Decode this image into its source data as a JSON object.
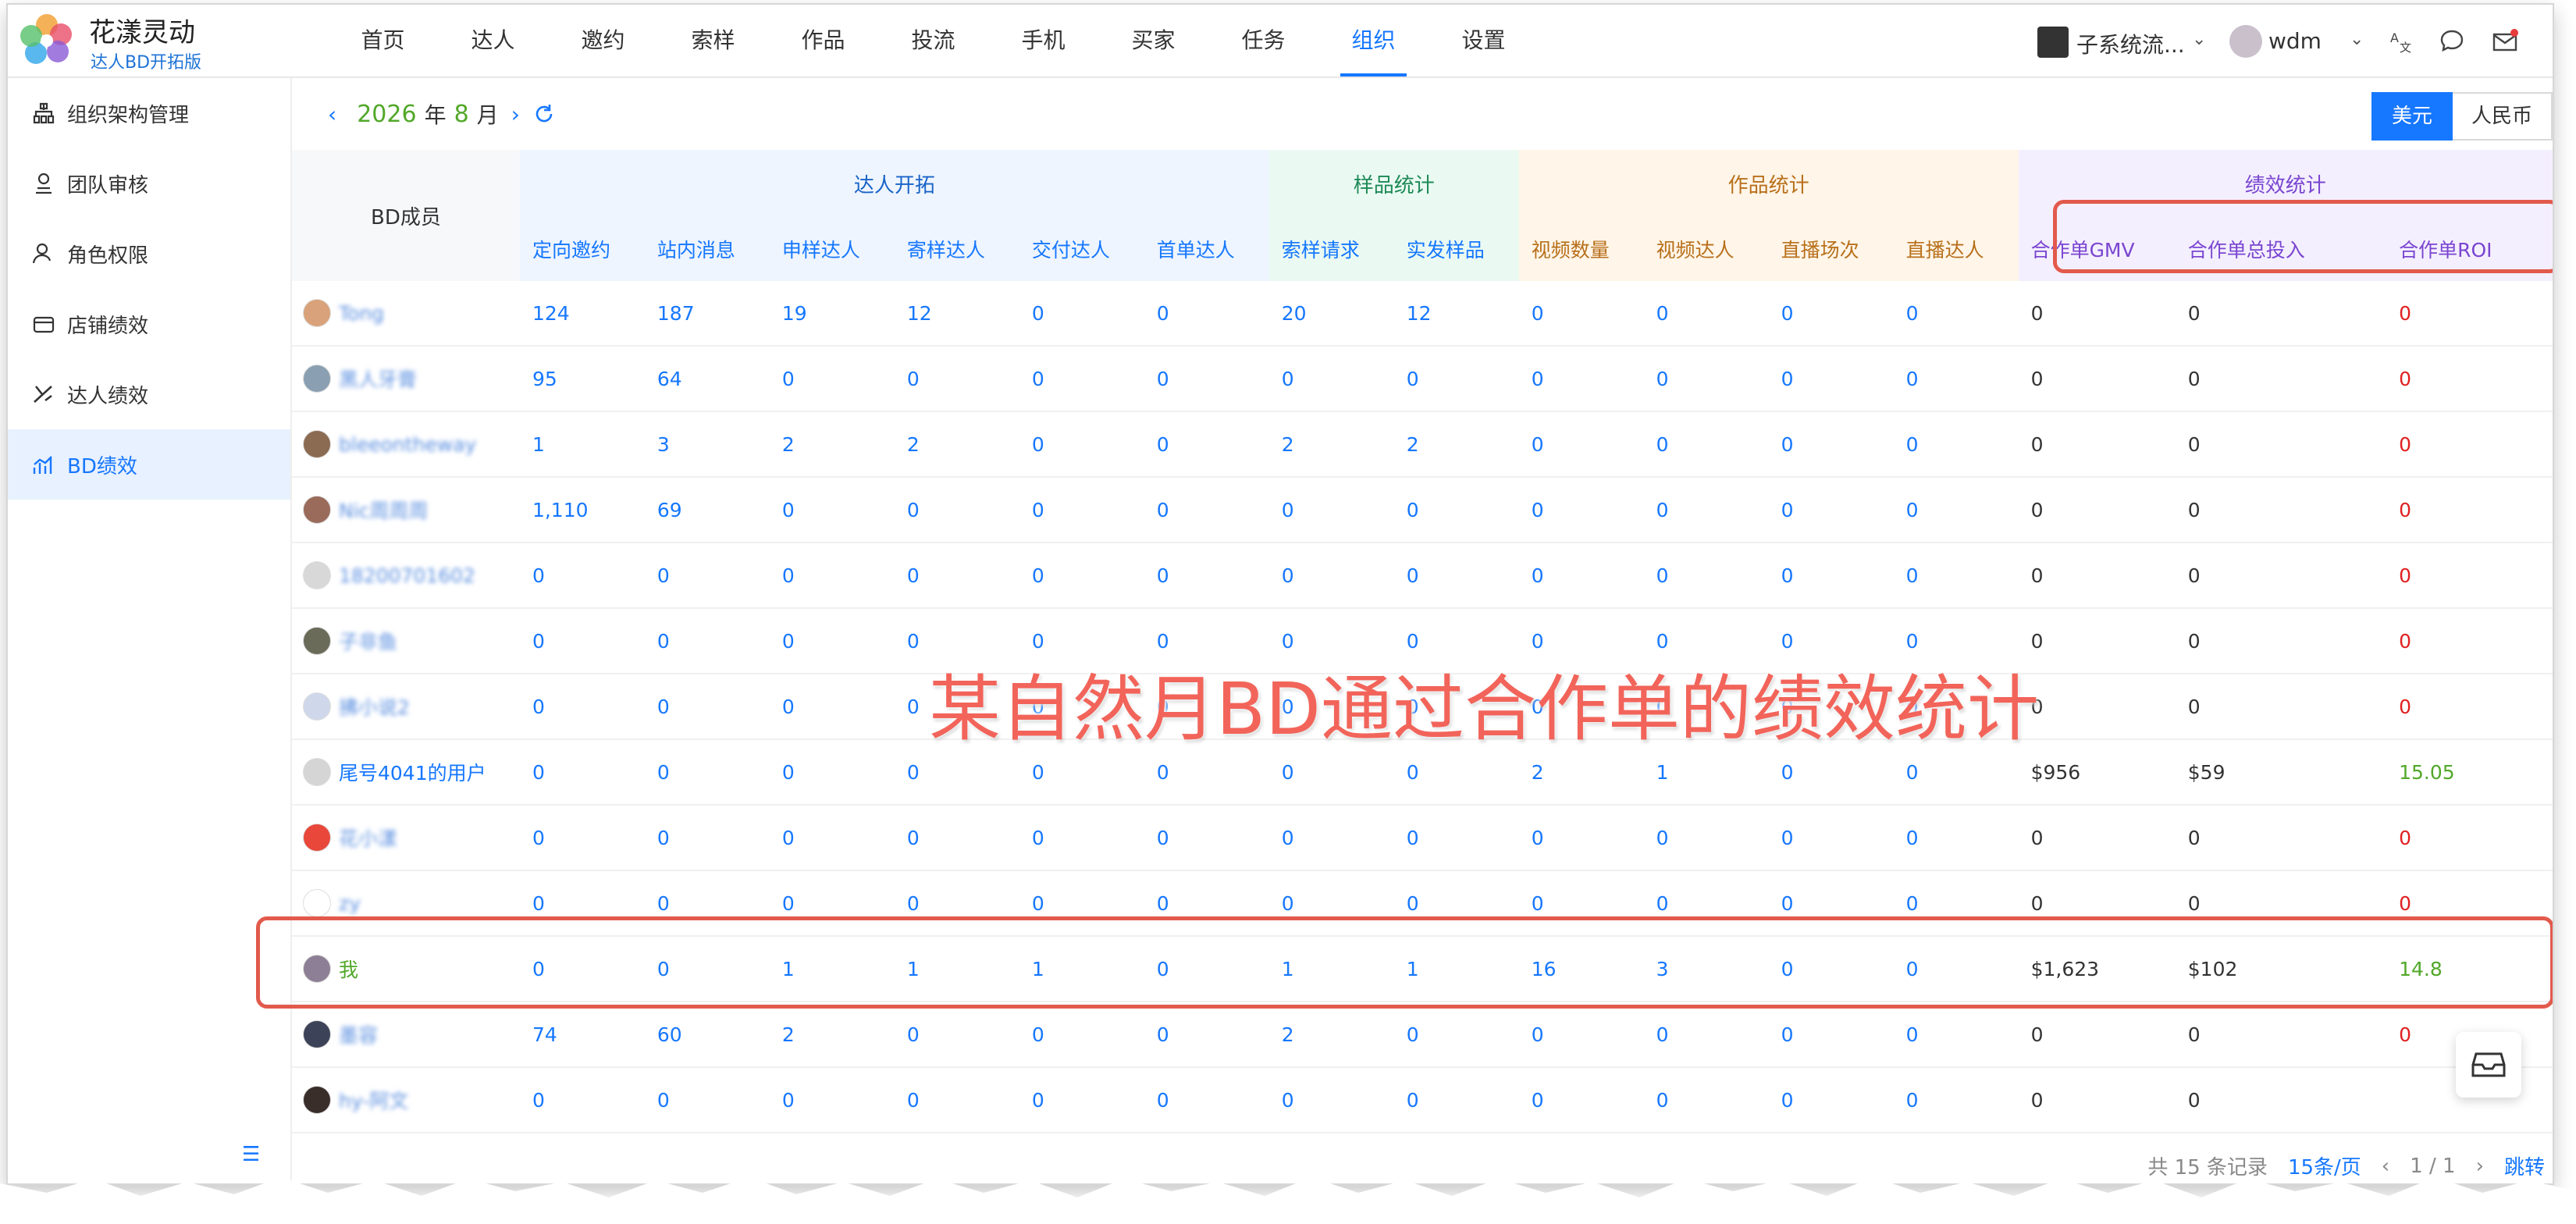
{
  "app": {
    "title": "花漾灵动",
    "subtitle": "达人BD开拓版"
  },
  "nav": [
    "首页",
    "达人",
    "邀约",
    "索样",
    "作品",
    "投流",
    "手机",
    "买家",
    "任务",
    "组织",
    "设置"
  ],
  "nav_active_index": 9,
  "topbar": {
    "subsystem": "子系统流...",
    "user": "wdm"
  },
  "sidebar": [
    "组织架构管理",
    "团队审核",
    "角色权限",
    "店铺绩效",
    "达人绩效",
    "BD绩效"
  ],
  "sidebar_active_index": 5,
  "datebar": {
    "year": "2026",
    "year_unit": "年",
    "month": "8",
    "month_unit": "月"
  },
  "currency": {
    "usd": "美元",
    "cny": "人民币"
  },
  "table": {
    "bd_header": "BD成员",
    "groups": [
      "达人开拓",
      "样品统计",
      "作品统计",
      "绩效统计"
    ],
    "columns": [
      "定向邀约",
      "站内消息",
      "申样达人",
      "寄样达人",
      "交付达人",
      "首单达人",
      "索样请求",
      "实发样品",
      "视频数量",
      "视频达人",
      "直播场次",
      "直播达人",
      "合作单GMV",
      "合作单总投入",
      "合作单ROI"
    ],
    "rows": [
      {
        "name": "Tong",
        "avatar": "#d9a27a",
        "blurred": true,
        "v": [
          "124",
          "187",
          "19",
          "12",
          "0",
          "0",
          "20",
          "12",
          "0",
          "0",
          "0",
          "0",
          "0",
          "0",
          "0"
        ]
      },
      {
        "name": "黑人牙膏",
        "avatar": "#8aa0b2",
        "blurred": true,
        "v": [
          "95",
          "64",
          "0",
          "0",
          "0",
          "0",
          "0",
          "0",
          "0",
          "0",
          "0",
          "0",
          "0",
          "0",
          "0"
        ]
      },
      {
        "name": "bleeontheway",
        "avatar": "#8b6b52",
        "blurred": true,
        "v": [
          "1",
          "3",
          "2",
          "2",
          "0",
          "0",
          "2",
          "2",
          "0",
          "0",
          "0",
          "0",
          "0",
          "0",
          "0"
        ]
      },
      {
        "name": "Nic周周周",
        "avatar": "#9a6a5a",
        "blurred": true,
        "v": [
          "1,110",
          "69",
          "0",
          "0",
          "0",
          "0",
          "0",
          "0",
          "0",
          "0",
          "0",
          "0",
          "0",
          "0",
          "0"
        ]
      },
      {
        "name": "18200701602",
        "avatar": "#d8d8d8",
        "blurred": true,
        "v": [
          "0",
          "0",
          "0",
          "0",
          "0",
          "0",
          "0",
          "0",
          "0",
          "0",
          "0",
          "0",
          "0",
          "0",
          "0"
        ]
      },
      {
        "name": "子非鱼",
        "avatar": "#6b6b5a",
        "blurred": true,
        "v": [
          "0",
          "0",
          "0",
          "0",
          "0",
          "0",
          "0",
          "0",
          "0",
          "0",
          "0",
          "0",
          "0",
          "0",
          "0"
        ]
      },
      {
        "name": "拂小说2",
        "avatar": "#cfd8ea",
        "blurred": true,
        "v": [
          "0",
          "0",
          "0",
          "0",
          "0",
          "0",
          "0",
          "0",
          "0",
          "0",
          "0",
          "0",
          "0",
          "0",
          "0"
        ]
      },
      {
        "name": "尾号4041的用户",
        "avatar": "#d5d5d5",
        "blurred": false,
        "v": [
          "0",
          "0",
          "0",
          "0",
          "0",
          "0",
          "0",
          "0",
          "2",
          "1",
          "0",
          "0",
          "$956",
          "$59",
          "15.05"
        ]
      },
      {
        "name": "花小漾",
        "avatar": "#e8473a",
        "blurred": true,
        "v": [
          "0",
          "0",
          "0",
          "0",
          "0",
          "0",
          "0",
          "0",
          "0",
          "0",
          "0",
          "0",
          "0",
          "0",
          "0"
        ]
      },
      {
        "name": "zy",
        "avatar": "#ffffff",
        "blurred": true,
        "v": [
          "0",
          "0",
          "0",
          "0",
          "0",
          "0",
          "0",
          "0",
          "0",
          "0",
          "0",
          "0",
          "0",
          "0",
          "0"
        ]
      },
      {
        "name": "我",
        "avatar": "#8d7f95",
        "blurred": false,
        "me": true,
        "v": [
          "0",
          "0",
          "1",
          "1",
          "1",
          "0",
          "1",
          "1",
          "16",
          "3",
          "0",
          "0",
          "$1,623",
          "$102",
          "14.8"
        ]
      },
      {
        "name": "墨容",
        "avatar": "#3c4258",
        "blurred": true,
        "v": [
          "74",
          "60",
          "2",
          "0",
          "0",
          "0",
          "2",
          "0",
          "0",
          "0",
          "0",
          "0",
          "0",
          "0",
          "0"
        ]
      },
      {
        "name": "hy-阿文",
        "avatar": "#3a2e2a",
        "blurred": true,
        "v": [
          "0",
          "0",
          "0",
          "0",
          "0",
          "0",
          "0",
          "0",
          "0",
          "0",
          "0",
          "0",
          "0",
          "0",
          ""
        ]
      }
    ]
  },
  "pager": {
    "total": "共 15 条记录",
    "page_size": "15条/页",
    "page": "1 / 1",
    "jump": "跳转"
  },
  "annotation": "某自然月BD通过合作单的绩效统计"
}
